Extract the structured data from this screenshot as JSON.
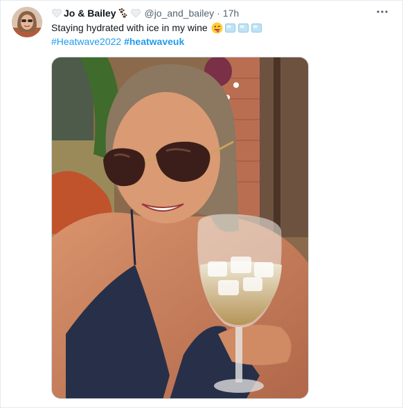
{
  "tweet": {
    "author_name": "Jo & Bailey",
    "handle": "@jo_and_bailey",
    "separator": "·",
    "time": "17h",
    "text": "Staying hydrated with ice in my wine",
    "hashtags": [
      "#Heatwave2022",
      "#heatwaveuk"
    ],
    "emojis": [
      "winking-face-tongue-emoji",
      "ice-cube-emoji",
      "ice-cube-emoji",
      "ice-cube-emoji"
    ],
    "name_icons": [
      "white-heart-icon",
      "paw-prints-icon",
      "white-heart-icon"
    ]
  },
  "colors": {
    "link": "#1d9bf0",
    "secondary_text": "#536471",
    "primary_text": "#0f1419",
    "border": "#cfd9de"
  }
}
